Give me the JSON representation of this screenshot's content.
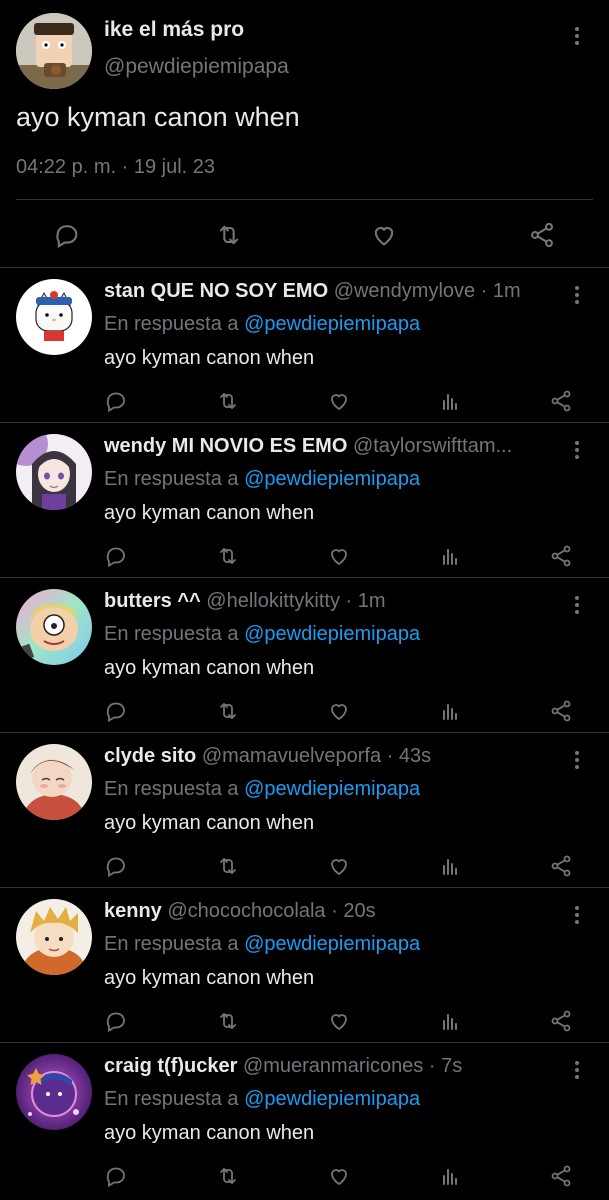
{
  "main_tweet": {
    "display_name": "ike el más pro",
    "handle": "@pewdiepiemipapa",
    "text": "ayo kyman canon when",
    "meta": "04:22 p. m. · 19 jul. 23"
  },
  "replies": [
    {
      "name": "stan QUE NO SOY EMO",
      "handle": "@wendymylove",
      "time": "· 1m",
      "in_reply_label": "En respuesta a",
      "mention": "@pewdiepiemipapa",
      "text": "ayo kyman canon when"
    },
    {
      "name": "wendy MI NOVIO ES EMO",
      "handle": "@taylorswifttam...",
      "time": "",
      "in_reply_label": "En respuesta a",
      "mention": "@pewdiepiemipapa",
      "text": "ayo kyman canon when"
    },
    {
      "name": "butters ^^",
      "handle": "@hellokittykitty",
      "time": "· 1m",
      "in_reply_label": "En respuesta a",
      "mention": "@pewdiepiemipapa",
      "text": "ayo kyman canon when"
    },
    {
      "name": "clyde sito",
      "handle": "@mamavuelveporfa",
      "time": "· 43s",
      "in_reply_label": "En respuesta a",
      "mention": "@pewdiepiemipapa",
      "text": "ayo kyman canon when"
    },
    {
      "name": "kenny",
      "handle": "@chocochocolala",
      "time": "· 20s",
      "in_reply_label": "En respuesta a",
      "mention": "@pewdiepiemipapa",
      "text": "ayo kyman canon when"
    },
    {
      "name": "craig t(f)ucker",
      "handle": "@mueranmaricones",
      "time": "· 7s",
      "in_reply_label": "En respuesta a",
      "mention": "@pewdiepiemipapa",
      "text": "ayo kyman canon when"
    }
  ],
  "icons": {
    "reply": "comment-icon",
    "retweet": "retweet-icon",
    "like": "heart-icon",
    "views": "analytics-icon",
    "share": "share-icon",
    "more": "more-vertical-icon"
  },
  "colors": {
    "background": "#000000",
    "text_primary": "#e7e9ea",
    "text_secondary": "#71767b",
    "accent": "#1d9bf0",
    "divider": "#2f3336"
  }
}
